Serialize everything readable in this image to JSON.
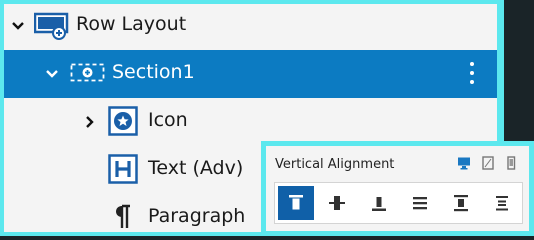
{
  "tree": {
    "items": [
      {
        "label": "Row Layout",
        "icon": "row-layout-icon",
        "expanded": true
      },
      {
        "label": "Section1",
        "icon": "section-icon",
        "expanded": true,
        "selected": true
      },
      {
        "label": "Icon",
        "icon": "icon-component-icon",
        "expanded": false
      },
      {
        "label": "Text (Adv)",
        "icon": "text-adv-icon"
      },
      {
        "label": "Paragraph",
        "icon": "paragraph-icon"
      }
    ]
  },
  "vertical_alignment": {
    "title": "Vertical Alignment",
    "devices": [
      "desktop-icon",
      "tablet-icon",
      "mobile-icon"
    ],
    "active_device": "desktop-icon",
    "options": [
      "align-top-icon",
      "align-middle-icon",
      "align-bottom-icon",
      "space-between-icon",
      "space-around-icon",
      "space-evenly-icon"
    ],
    "selected_option": "align-top-icon"
  },
  "colors": {
    "selection": "#0c7bc2",
    "accent_border": "#5ce8ee",
    "icon_blue": "#1a5fa8",
    "active_button": "#1060a8"
  }
}
